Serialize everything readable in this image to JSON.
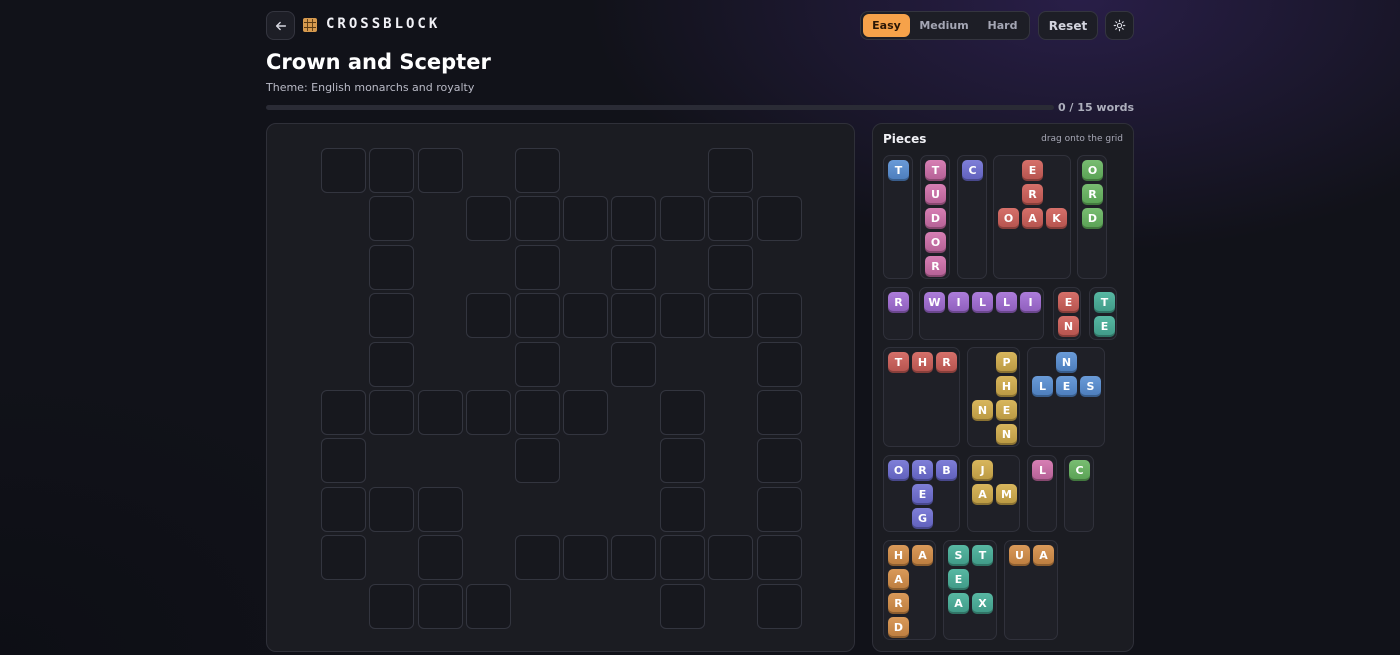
{
  "header": {
    "logo_text": "CROSSBLOCK",
    "back_icon": "arrow-left-icon",
    "logo_icon": "grid-icon",
    "difficulty": [
      {
        "label": "Easy",
        "selected": true
      },
      {
        "label": "Medium",
        "selected": false
      },
      {
        "label": "Hard",
        "selected": false
      }
    ],
    "reset_label": "Reset",
    "theme_icon": "sun-icon",
    "accent_color": "#f6a24a"
  },
  "puzzle": {
    "title": "Crown and Scepter",
    "theme": "Theme: English monarchs and royalty",
    "progress_label": "0 / 15 words",
    "words_found": 0,
    "words_total": 15
  },
  "grid": {
    "rows": 10,
    "cols": 10,
    "open_cells": [
      [
        0,
        0
      ],
      [
        0,
        1
      ],
      [
        0,
        2
      ],
      [
        0,
        4
      ],
      [
        0,
        8
      ],
      [
        1,
        1
      ],
      [
        1,
        3
      ],
      [
        1,
        4
      ],
      [
        1,
        5
      ],
      [
        1,
        6
      ],
      [
        1,
        7
      ],
      [
        1,
        8
      ],
      [
        1,
        9
      ],
      [
        2,
        1
      ],
      [
        2,
        4
      ],
      [
        2,
        6
      ],
      [
        2,
        8
      ],
      [
        3,
        1
      ],
      [
        3,
        3
      ],
      [
        3,
        4
      ],
      [
        3,
        5
      ],
      [
        3,
        6
      ],
      [
        3,
        7
      ],
      [
        3,
        8
      ],
      [
        3,
        9
      ],
      [
        4,
        1
      ],
      [
        4,
        4
      ],
      [
        4,
        6
      ],
      [
        4,
        9
      ],
      [
        5,
        0
      ],
      [
        5,
        1
      ],
      [
        5,
        2
      ],
      [
        5,
        3
      ],
      [
        5,
        4
      ],
      [
        5,
        5
      ],
      [
        5,
        7
      ],
      [
        5,
        9
      ],
      [
        6,
        0
      ],
      [
        6,
        4
      ],
      [
        6,
        7
      ],
      [
        6,
        9
      ],
      [
        7,
        0
      ],
      [
        7,
        1
      ],
      [
        7,
        2
      ],
      [
        7,
        7
      ],
      [
        7,
        9
      ],
      [
        8,
        0
      ],
      [
        8,
        2
      ],
      [
        8,
        4
      ],
      [
        8,
        5
      ],
      [
        8,
        6
      ],
      [
        8,
        7
      ],
      [
        8,
        8
      ],
      [
        8,
        9
      ],
      [
        9,
        1
      ],
      [
        9,
        2
      ],
      [
        9,
        3
      ],
      [
        9,
        7
      ],
      [
        9,
        9
      ]
    ]
  },
  "pieces_panel": {
    "title": "Pieces",
    "hint": "drag onto the grid",
    "pieces": [
      {
        "color": "blue",
        "tiles": [
          [
            0,
            0,
            "T"
          ]
        ]
      },
      {
        "color": "pink",
        "tiles": [
          [
            0,
            0,
            "T"
          ],
          [
            0,
            1,
            "U"
          ],
          [
            0,
            2,
            "D"
          ],
          [
            0,
            3,
            "O"
          ],
          [
            0,
            4,
            "R"
          ]
        ]
      },
      {
        "color": "indigo",
        "tiles": [
          [
            0,
            0,
            "C"
          ]
        ]
      },
      {
        "color": "red",
        "tiles": [
          [
            1,
            0,
            "E"
          ],
          [
            1,
            1,
            "R"
          ],
          [
            0,
            2,
            "O"
          ],
          [
            1,
            2,
            "A"
          ],
          [
            2,
            2,
            "K"
          ]
        ]
      },
      {
        "color": "green",
        "tiles": [
          [
            0,
            0,
            "O"
          ],
          [
            0,
            1,
            "R"
          ],
          [
            0,
            2,
            "D"
          ]
        ]
      },
      {
        "color": "purple",
        "tiles": [
          [
            0,
            0,
            "R"
          ]
        ]
      },
      {
        "color": "purple",
        "tiles": [
          [
            0,
            0,
            "W"
          ],
          [
            1,
            0,
            "I"
          ],
          [
            2,
            0,
            "L"
          ],
          [
            3,
            0,
            "L"
          ],
          [
            4,
            0,
            "I"
          ]
        ]
      },
      {
        "color": "red",
        "tiles": [
          [
            0,
            0,
            "E"
          ],
          [
            0,
            1,
            "N"
          ]
        ]
      },
      {
        "color": "teal",
        "tiles": [
          [
            0,
            0,
            "T"
          ],
          [
            0,
            1,
            "E"
          ]
        ]
      },
      {
        "color": "red",
        "tiles": [
          [
            0,
            0,
            "T"
          ],
          [
            1,
            0,
            "H"
          ],
          [
            2,
            0,
            "R"
          ]
        ]
      },
      {
        "color": "gold",
        "tiles": [
          [
            1,
            0,
            "P"
          ],
          [
            1,
            1,
            "H"
          ],
          [
            0,
            2,
            "N"
          ],
          [
            1,
            2,
            "E"
          ],
          [
            1,
            3,
            "N"
          ]
        ]
      },
      {
        "color": "blue",
        "tiles": [
          [
            1,
            0,
            "N"
          ],
          [
            0,
            1,
            "L"
          ],
          [
            1,
            1,
            "E"
          ],
          [
            2,
            1,
            "S"
          ]
        ]
      },
      {
        "color": "indigo",
        "tiles": [
          [
            0,
            0,
            "O"
          ],
          [
            1,
            0,
            "R"
          ],
          [
            2,
            0,
            "B"
          ],
          [
            1,
            1,
            "E"
          ],
          [
            1,
            2,
            "G"
          ]
        ]
      },
      {
        "color": "gold",
        "tiles": [
          [
            0,
            0,
            "J"
          ],
          [
            0,
            1,
            "A"
          ],
          [
            1,
            1,
            "M"
          ]
        ]
      },
      {
        "color": "pink",
        "tiles": [
          [
            0,
            0,
            "L"
          ]
        ]
      },
      {
        "color": "green",
        "tiles": [
          [
            0,
            0,
            "C"
          ]
        ]
      },
      {
        "color": "orange",
        "tiles": [
          [
            0,
            0,
            "H"
          ],
          [
            1,
            0,
            "A"
          ],
          [
            0,
            1,
            "A"
          ],
          [
            0,
            2,
            "R"
          ],
          [
            0,
            3,
            "D"
          ]
        ]
      },
      {
        "color": "teal",
        "tiles": [
          [
            0,
            0,
            "S"
          ],
          [
            1,
            0,
            "T"
          ],
          [
            0,
            1,
            "E"
          ],
          [
            0,
            2,
            "A"
          ],
          [
            1,
            2,
            "X"
          ]
        ]
      },
      {
        "color": "orange",
        "tiles": [
          [
            0,
            0,
            "U"
          ],
          [
            1,
            0,
            "A"
          ]
        ]
      }
    ]
  }
}
